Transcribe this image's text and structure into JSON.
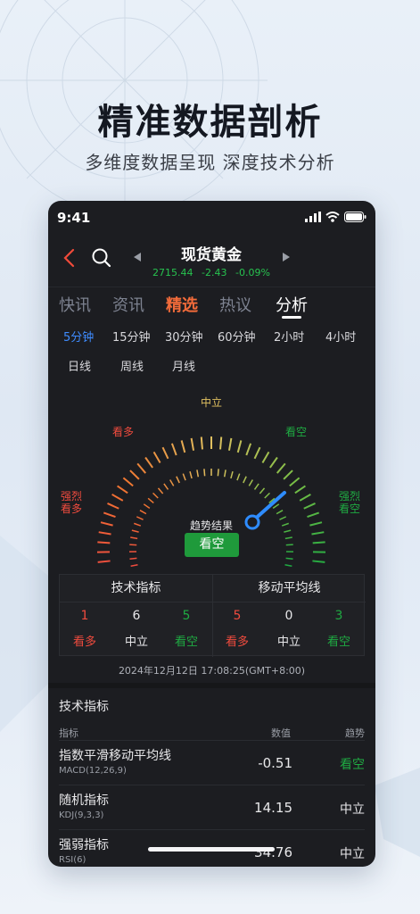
{
  "headline": "精准数据剖析",
  "subline": "多维度数据呈现  深度技术分析",
  "colors": {
    "up": "#ef4b3e",
    "down": "#1faa42",
    "accent": "#f26b3a",
    "active_period": "#3f8cff",
    "neutral": "#e0c060"
  },
  "status": {
    "time": "9:41"
  },
  "nav": {
    "title": "现货黄金",
    "price": "2715.44",
    "change": "-2.43",
    "change_pct": "-0.09%",
    "back_icon": "chevron-left-icon",
    "search_icon": "search-icon"
  },
  "tabs": [
    "快讯",
    "资讯",
    "精选",
    "热议",
    "分析"
  ],
  "active_tab": "分析",
  "periods": [
    "5分钟",
    "15分钟",
    "30分钟",
    "60分钟",
    "2小时",
    "4小时",
    "日线",
    "周线",
    "月线"
  ],
  "active_period": "5分钟",
  "gauge": {
    "labels": {
      "strong_buy_1": "强烈",
      "strong_buy_2": "看多",
      "buy": "看多",
      "neutral": "中立",
      "sell": "看空",
      "strong_sell_1": "强烈",
      "strong_sell_2": "看空"
    },
    "result_caption": "趋势结果",
    "result": "看空"
  },
  "summary": {
    "technical": {
      "title": "技术指标",
      "buy": "1",
      "neutral": "6",
      "sell": "5"
    },
    "moving_avg": {
      "title": "移动平均线",
      "buy": "5",
      "neutral": "0",
      "sell": "3"
    },
    "buy_label": "看多",
    "neutral_label": "中立",
    "sell_label": "看空"
  },
  "timestamp": "2024年12月12日 17:08:25(GMT+8:00)",
  "indicators": {
    "title": "技术指标",
    "headers": {
      "name": "指标",
      "value": "数值",
      "trend": "趋势"
    },
    "rows": [
      {
        "name": "指数平滑移动平均线",
        "param": "MACD(12,26,9)",
        "value": "-0.51",
        "trend": "看空"
      },
      {
        "name": "随机指标",
        "param": "KDJ(9,3,3)",
        "value": "14.15",
        "trend": "中立"
      },
      {
        "name": "强弱指标",
        "param": "RSI(6)",
        "value": "34.76",
        "trend": "中立"
      }
    ]
  }
}
